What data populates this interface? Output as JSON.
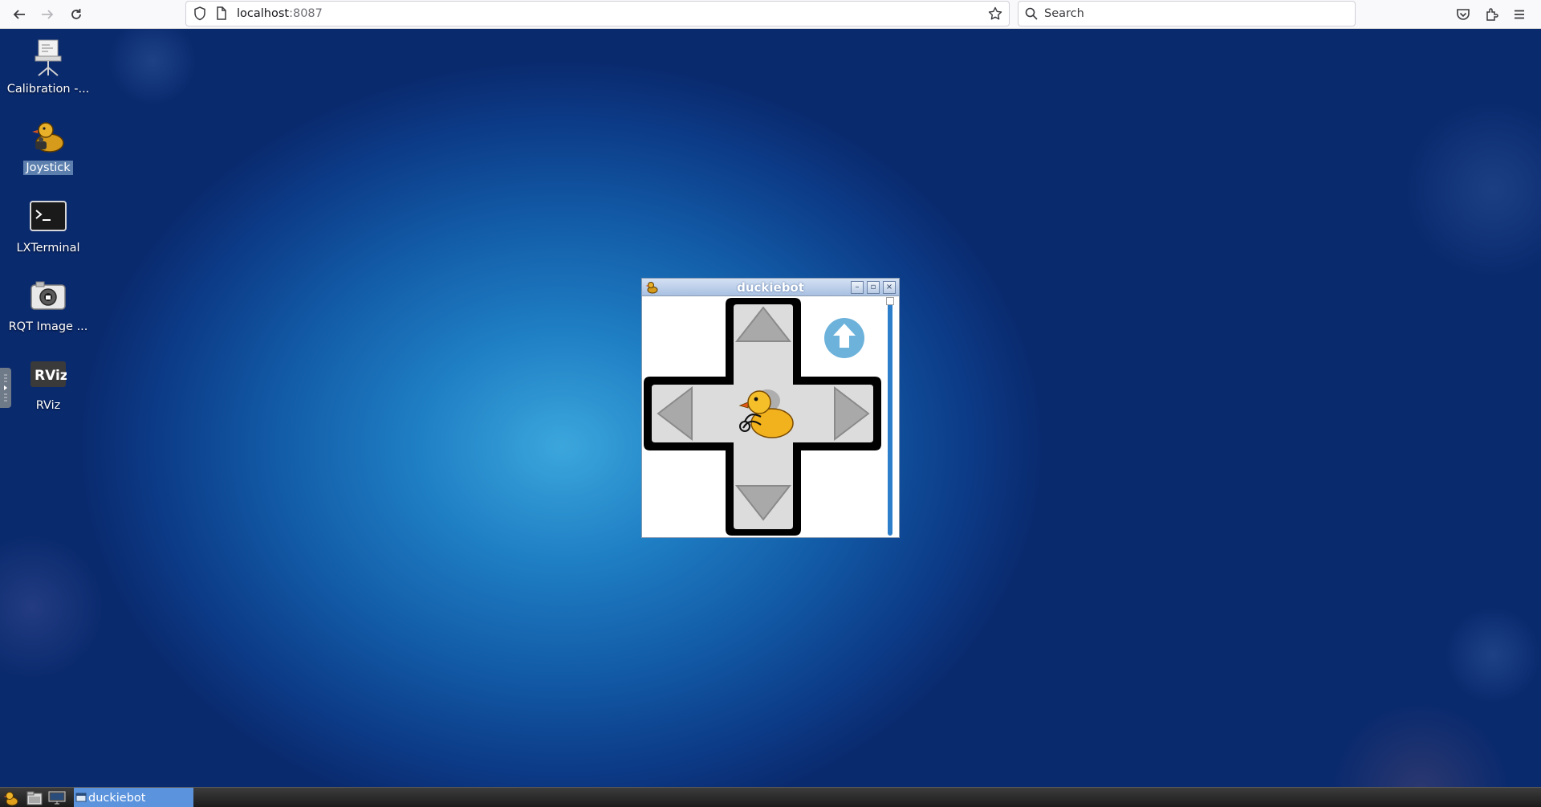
{
  "browser": {
    "url_host": "localhost",
    "url_port": ":8087",
    "search_placeholder": "Search",
    "icons": [
      "back-arrow-icon",
      "forward-arrow-icon",
      "reload-icon",
      "shield-icon",
      "page-icon",
      "star-icon",
      "search-icon",
      "pocket-icon",
      "extensions-icon",
      "menu-icon"
    ]
  },
  "desktop": {
    "icons": [
      {
        "label": "Calibration -...",
        "icon": "calibration-projector-icon"
      },
      {
        "label": "Joystick",
        "icon": "duck-joystick-icon",
        "selected": true
      },
      {
        "label": "LXTerminal",
        "icon": "terminal-icon"
      },
      {
        "label": "RQT Image ...",
        "icon": "camera-icon"
      },
      {
        "label": "RViz",
        "icon": "rviz-icon"
      }
    ]
  },
  "window": {
    "title": "duckiebot",
    "controls": [
      "minimize",
      "maximize",
      "close"
    ],
    "dpad": [
      "up-arrow",
      "left-arrow",
      "right-arrow",
      "down-arrow"
    ],
    "center_icon": "duckiebot-duck-icon",
    "up_indicator_icon": "blue-up-arrow-circle-icon"
  },
  "taskbar": {
    "task_label": "duckiebot",
    "icons": [
      "duck-menu-icon",
      "file-manager-icon",
      "show-desktop-icon"
    ]
  },
  "colors": {
    "title_bar": "#a9c0e2",
    "taskbar_active": "#5b93dd",
    "selected_label": "#5c7fae",
    "up_indicator": "#6cb2db"
  }
}
